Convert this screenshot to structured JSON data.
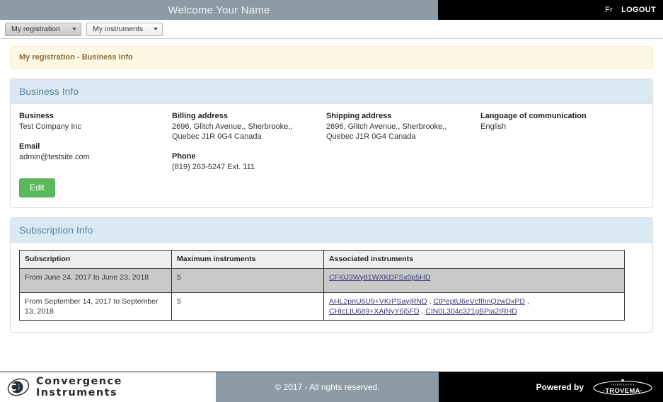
{
  "topbar": {
    "welcome": "Welcome  Your Name",
    "lang_label": "Fr",
    "logout_label": "LOGOUT"
  },
  "nav": {
    "items": [
      {
        "label": "My registration",
        "active": true
      },
      {
        "label": "My instruments",
        "active": false
      }
    ]
  },
  "breadcrumb": {
    "text": "My registration - Business info"
  },
  "business_panel": {
    "title": "Business Info",
    "fields": {
      "business_label": "Business",
      "business_value": "Test Company Inc",
      "email_label": "Email",
      "email_value": "admin@testsite.com",
      "billing_label": "Billing address",
      "billing_value": "2696, Glitch Avenue,, Sherbrooke,, Quebec J1R 0G4 Canada",
      "phone_label": "Phone",
      "phone_value": "(819) 263-5247 Ext. 111",
      "shipping_label": "Shipping address",
      "shipping_value": "2696, Glitch Avenue,, Sherbrooke,, Quebec J1R 0G4 Canada",
      "language_label": "Language of communication",
      "language_value": "English"
    },
    "edit_label": "Edit"
  },
  "subscription_panel": {
    "title": "Subscription Info",
    "columns": [
      "Subscription",
      "Maximum instruments",
      "Associated instruments"
    ],
    "rows": [
      {
        "subscription": "From June 24, 2017 to June 23, 2018",
        "maximum": "5",
        "instruments": [
          "CFI0J3Wy81WXKDFSx0p5HD"
        ]
      },
      {
        "subscription": "From September 14, 2017 to September 13, 2018",
        "maximum": "5",
        "instruments": [
          "AHL2pnU6U9+VKrPSayjRND",
          "CtPeptU6eVcfIhnQzwDxPD",
          "CHIcLtU689+XAjNyY6j5FD",
          "CIN0L304c321gBPia2IRHD"
        ]
      }
    ]
  },
  "footer": {
    "brand_line1": "Convergence",
    "brand_line2": "Instruments",
    "copyright": "© 2017 - All rights reserved.",
    "powered_by": "Powered by",
    "partner_name": "TROVEMA",
    "partner_tagline": "TECHNOLOGIES"
  },
  "colors": {
    "banner": "#8c9ba5",
    "panel_heading": "#dbeaf2",
    "panel_heading_text": "#5b87a5",
    "alert_bg": "#fcf8e3",
    "alert_text": "#8a6d3b",
    "edit_button": "#5cb85c",
    "link": "#3c3c7a"
  }
}
